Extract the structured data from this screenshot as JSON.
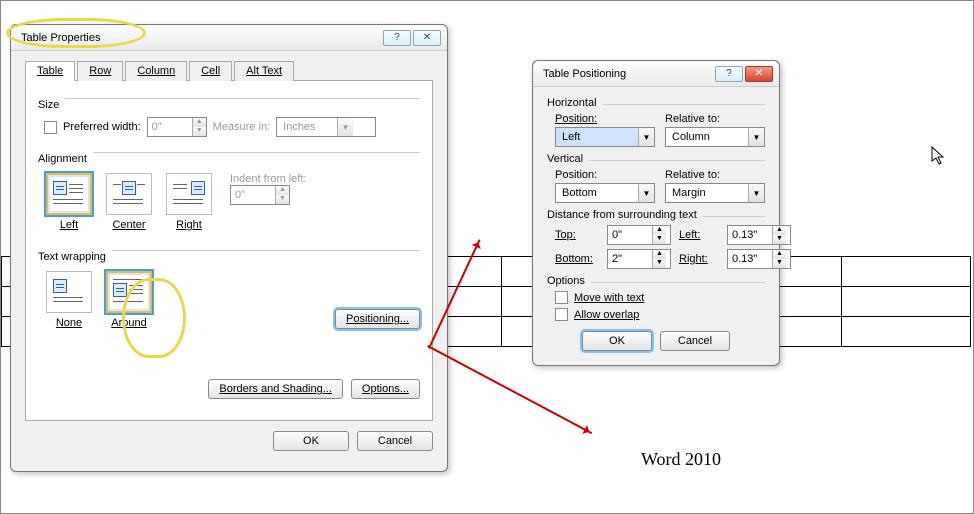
{
  "caption": "Word 2010",
  "tp": {
    "title": "Table Properties",
    "tabs": {
      "table": "Table",
      "row": "Row",
      "column": "Column",
      "cell": "Cell",
      "alttext": "Alt Text"
    },
    "size_label": "Size",
    "pref_width": "Preferred width:",
    "pref_width_val": "0\"",
    "measure_in": "Measure in:",
    "measure_val": "Inches",
    "align_label": "Alignment",
    "indent_label": "Indent from left:",
    "indent_val": "0\"",
    "align": {
      "left": "Left",
      "center": "Center",
      "right": "Right"
    },
    "wrap_label": "Text wrapping",
    "wrap": {
      "none": "None",
      "around": "Around"
    },
    "positioning_btn": "Positioning...",
    "borders_btn": "Borders and Shading...",
    "options_btn": "Options...",
    "ok": "OK",
    "cancel": "Cancel"
  },
  "pos": {
    "title": "Table Positioning",
    "horizontal": "Horizontal",
    "vertical": "Vertical",
    "position": "Position:",
    "relative": "Relative to:",
    "h_pos": "Left",
    "h_rel": "Column",
    "v_pos": "Bottom",
    "v_rel": "Margin",
    "dist_label": "Distance from surrounding text",
    "top": "Top:",
    "bottom": "Bottom:",
    "left": "Left:",
    "right": "Right:",
    "top_v": "0\"",
    "bottom_v": "2\"",
    "left_v": "0.13\"",
    "right_v": "0.13\"",
    "options": "Options",
    "move": "Move with text",
    "overlap": "Allow overlap",
    "ok": "OK",
    "cancel": "Cancel"
  }
}
